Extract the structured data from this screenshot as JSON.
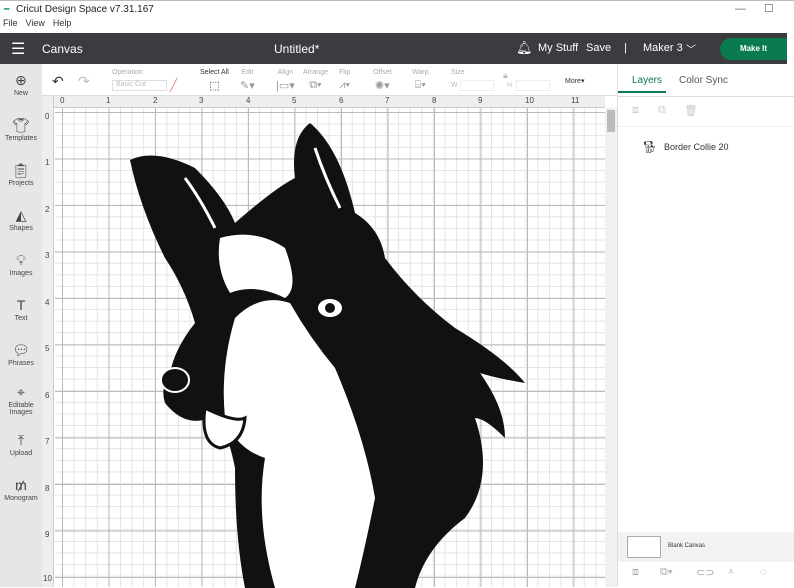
{
  "window": {
    "title": "Cricut Design Space  v7.31.167",
    "min": "—",
    "max": "☐"
  },
  "menu": [
    "File",
    "View",
    "Help"
  ],
  "header": {
    "section": "Canvas",
    "doc_title": "Untitled*",
    "my_stuff": "My Stuff",
    "save": "Save",
    "separator": "|",
    "machine": "Maker 3",
    "make_it": "Make It"
  },
  "toolbar": {
    "operation_label": "Operation",
    "operation_value": "Basic Cut",
    "select_all": "Select All",
    "edit": "Edit",
    "align": "Align",
    "arrange": "Arrange",
    "flip": "Flip",
    "offset": "Offset",
    "warp": "Warp",
    "size": "Size",
    "w": "W",
    "h": "H",
    "more": "More▾"
  },
  "sidebar": [
    "New",
    "Templates",
    "Projects",
    "Shapes",
    "Images",
    "Text",
    "Phrases",
    "Editable Images",
    "Upload",
    "Monogram"
  ],
  "ruler": {
    "h": [
      "0",
      "1",
      "2",
      "3",
      "4",
      "5",
      "6",
      "7",
      "8",
      "9",
      "10",
      "11"
    ],
    "v": [
      "0",
      "1",
      "2",
      "3",
      "4",
      "5",
      "6",
      "7",
      "8",
      "9",
      "10"
    ]
  },
  "panel": {
    "tabs": [
      "Layers",
      "Color Sync"
    ],
    "layer": "Border Collie 20",
    "blank_canvas": "Blank Canvas"
  },
  "colors": {
    "accent": "#0a7a4f",
    "header": "#3a3c3f"
  }
}
